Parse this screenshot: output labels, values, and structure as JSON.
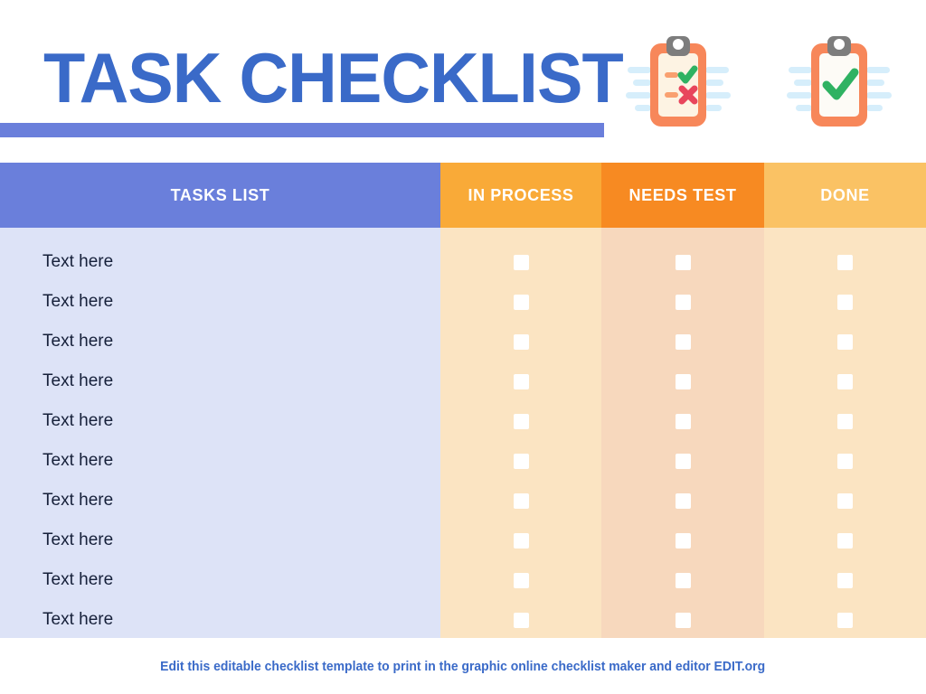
{
  "header": {
    "title": "TASK CHECKLIST",
    "icons": [
      {
        "name": "clipboard-check-cross-icon",
        "items": [
          "check",
          "cross"
        ]
      },
      {
        "name": "clipboard-check-icon",
        "items": [
          "check"
        ]
      }
    ]
  },
  "table": {
    "columns": [
      {
        "key": "tasks",
        "label": "TASKS LIST",
        "header_color": "#6a7fdb",
        "body_color": "#dde3f7"
      },
      {
        "key": "process",
        "label": "IN PROCESS",
        "header_color": "#f9aa38",
        "body_color": "#fbe4c2"
      },
      {
        "key": "test",
        "label": "NEEDS TEST",
        "header_color": "#f78a22",
        "body_color": "#f7d8bd"
      },
      {
        "key": "done",
        "label": "DONE",
        "header_color": "#fac264",
        "body_color": "#fbe4c2"
      }
    ],
    "rows": [
      {
        "task": "Text here",
        "process": false,
        "test": false,
        "done": false
      },
      {
        "task": "Text here",
        "process": false,
        "test": false,
        "done": false
      },
      {
        "task": "Text here",
        "process": false,
        "test": false,
        "done": false
      },
      {
        "task": "Text here",
        "process": false,
        "test": false,
        "done": false
      },
      {
        "task": "Text here",
        "process": false,
        "test": false,
        "done": false
      },
      {
        "task": "Text here",
        "process": false,
        "test": false,
        "done": false
      },
      {
        "task": "Text here",
        "process": false,
        "test": false,
        "done": false
      },
      {
        "task": "Text here",
        "process": false,
        "test": false,
        "done": false
      },
      {
        "task": "Text here",
        "process": false,
        "test": false,
        "done": false
      },
      {
        "task": "Text here",
        "process": false,
        "test": false,
        "done": false
      }
    ]
  },
  "footer": {
    "text": "Edit this editable checklist template to print in the graphic online checklist maker and editor EDIT.org"
  },
  "colors": {
    "title_blue": "#3a6ac8",
    "rule_blue": "#6a7fdb",
    "accent_orange": "#f78a22",
    "clipboard_orange": "#f7875a",
    "clipboard_clip_gray": "#7d7d7d",
    "check_green": "#2fb262",
    "cross_red": "#e8455c",
    "motion_line_blue": "#d6eefb"
  }
}
